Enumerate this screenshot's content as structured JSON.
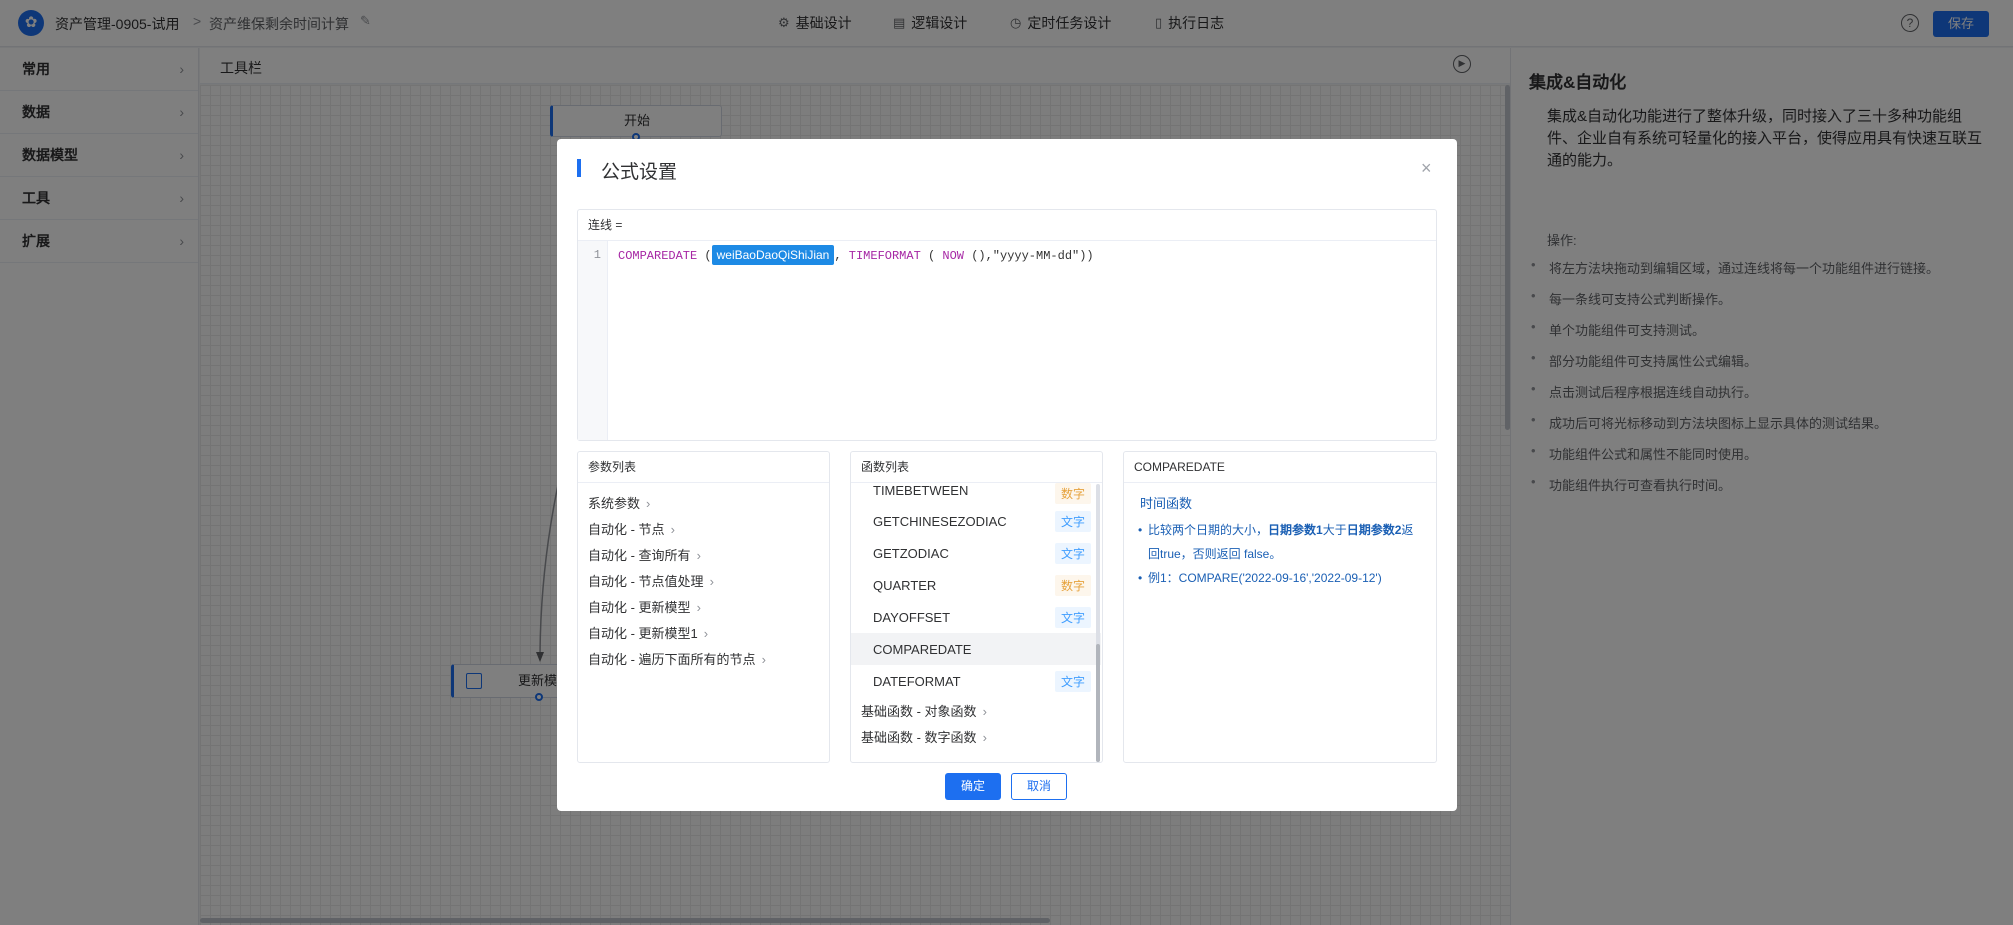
{
  "header": {
    "app_name": "资产管理-0905-试用",
    "page_name": "资产维保剩余时间计算",
    "breadcrumb_sep": ">",
    "tabs": [
      {
        "label": "基础设计",
        "icon": "gear-icon"
      },
      {
        "label": "逻辑设计",
        "icon": "logic-icon"
      },
      {
        "label": "定时任务设计",
        "icon": "clock-icon"
      },
      {
        "label": "执行日志",
        "icon": "document-icon"
      }
    ],
    "help_glyph": "?",
    "save_label": "保存"
  },
  "sidebar": {
    "items": [
      {
        "label": "常用"
      },
      {
        "label": "数据"
      },
      {
        "label": "数据模型"
      },
      {
        "label": "工具"
      },
      {
        "label": "扩展"
      }
    ]
  },
  "canvas": {
    "toolbar_title": "工具栏",
    "nodes": {
      "start": "开始",
      "update": "更新模型"
    }
  },
  "right_panel": {
    "title": "集成&自动化",
    "description": "集成&自动化功能进行了整体升级，同时接入了三十多种功能组件、企业自有系统可轻量化的接入平台，使得应用具有快速互联互通的能力。",
    "ops_title": "操作:",
    "ops": [
      "将左方法块拖动到编辑区域，通过连线将每一个功能组件进行链接。",
      "每一条线可支持公式判断操作。",
      "单个功能组件可支持测试。",
      "部分功能组件可支持属性公式编辑。",
      "点击测试后程序根据连线自动执行。",
      "成功后可将光标移动到方法块图标上显示具体的测试结果。",
      "功能组件公式和属性不能同时使用。",
      "功能组件执行可查看执行时间。"
    ]
  },
  "modal": {
    "title": "公式设置",
    "close_glyph": "×",
    "editor": {
      "header": "连线  =",
      "line_number": "1",
      "code": {
        "fn1": "COMPAREDATE",
        "open1": " (",
        "param": "weiBaoDaoQiShiJian",
        "comma": ", ",
        "fn2": "TIMEFORMAT",
        "open2": " ( ",
        "fn3": "NOW",
        "rest": " (),\"yyyy-MM-dd\"))"
      }
    },
    "params_panel": {
      "title": "参数列表",
      "items": [
        "系统参数",
        "自动化 - 节点",
        "自动化 - 查询所有",
        "自动化 - 节点值处理",
        "自动化 - 更新模型",
        "自动化 - 更新模型1",
        "自动化 - 遍历下面所有的节点"
      ]
    },
    "functions_panel": {
      "title": "函数列表",
      "items": [
        {
          "name": "TIMEBETWEEN",
          "tag": "数字",
          "tag_type": "num"
        },
        {
          "name": "GETCHINESEZODIAC",
          "tag": "文字",
          "tag_type": "txt"
        },
        {
          "name": "GETZODIAC",
          "tag": "文字",
          "tag_type": "txt"
        },
        {
          "name": "QUARTER",
          "tag": "数字",
          "tag_type": "num"
        },
        {
          "name": "DAYOFFSET",
          "tag": "文字",
          "tag_type": "txt"
        },
        {
          "name": "COMPAREDATE",
          "tag": "",
          "tag_type": "none"
        },
        {
          "name": "DATEFORMAT",
          "tag": "文字",
          "tag_type": "txt"
        }
      ],
      "groups": [
        "基础函数 - 对象函数",
        "基础函数 - 数字函数"
      ]
    },
    "doc_panel": {
      "title": "COMPAREDATE",
      "category": "时间函数",
      "desc_pre": "比较两个日期的大小，",
      "desc_b1": "日期参数1",
      "desc_mid": "大于",
      "desc_b2": "日期参数2",
      "desc_post": "返回true，否则返回 false。",
      "example": "例1：COMPARE('2022-09-16','2022-09-12')"
    },
    "ok_label": "确定",
    "cancel_label": "取消"
  },
  "colors": {
    "accent": "#1d6ff0",
    "number_tag": "#e6a23c",
    "text_tag": "#409eff",
    "formula_function": "#a626a4"
  }
}
